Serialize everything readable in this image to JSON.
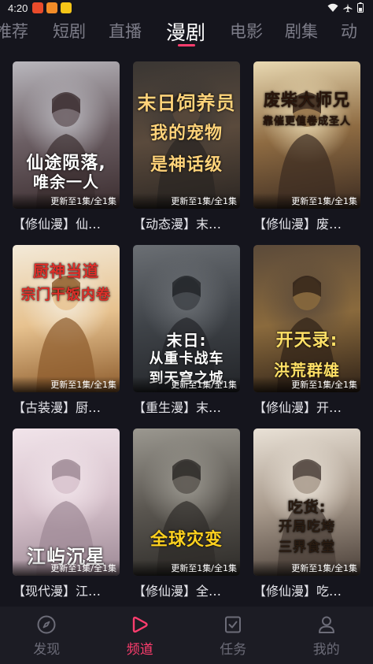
{
  "status_bar": {
    "time": "4:20"
  },
  "tabs": [
    {
      "label": "推荐"
    },
    {
      "label": "短剧"
    },
    {
      "label": "直播"
    },
    {
      "label": "漫剧",
      "active": true
    },
    {
      "label": "电影"
    },
    {
      "label": "剧集"
    },
    {
      "label": "动"
    }
  ],
  "cards": [
    {
      "title": "【修仙漫】仙…",
      "badge": "更新至1集/全1集",
      "cover_text": [
        "仙途陨落,",
        "唯余一人"
      ],
      "palette": [
        "#b9b7bd",
        "#6b5e63",
        "#3b2d2f"
      ],
      "accent": "#ffffff"
    },
    {
      "title": "【动态漫】末…",
      "badge": "更新至1集/全1集",
      "cover_text": [
        "末日饲养员",
        "我的宠物",
        "是神话级"
      ],
      "palette": [
        "#3a3633",
        "#5a4a3c",
        "#2a2522"
      ],
      "accent": "#ffd37a"
    },
    {
      "title": "【修仙漫】废…",
      "badge": "更新至1集/全1集",
      "cover_text": [
        "废柴大师兄",
        "靠催更值卷成圣人"
      ],
      "palette": [
        "#e9d9b2",
        "#8e6b42",
        "#3b2b21"
      ],
      "accent": "#2a160c"
    },
    {
      "title": "【古装漫】厨…",
      "badge": "更新至1集/全1集",
      "cover_text": [
        "厨神当道",
        "宗门干饭内卷"
      ],
      "palette": [
        "#f3ead9",
        "#e7c28f",
        "#8b5a2b"
      ],
      "accent": "#e0302a"
    },
    {
      "title": "【重生漫】末…",
      "badge": "更新至1集/全1集",
      "cover_text": [
        "末日:",
        "从重卡战车",
        "到天穹之城"
      ],
      "palette": [
        "#6b6f74",
        "#3f4348",
        "#222428"
      ],
      "accent": "#ffffff"
    },
    {
      "title": "【修仙漫】开…",
      "badge": "更新至1集/全1集",
      "cover_text": [
        "开天录:",
        "洪荒群雄"
      ],
      "palette": [
        "#5b4a3a",
        "#8a6a3d",
        "#2e2117"
      ],
      "accent": "#ffe066"
    },
    {
      "title": "【现代漫】江…",
      "badge": "更新至1集/全1集",
      "cover_text": [
        "江屿沉星"
      ],
      "palette": [
        "#f1e4ea",
        "#d7c2cc",
        "#9c8894"
      ],
      "accent": "#ffffff"
    },
    {
      "title": "【修仙漫】全…",
      "badge": "更新至1集/全1集",
      "cover_text": [
        "全球灾变"
      ],
      "palette": [
        "#9b9890",
        "#5a5650",
        "#2d2b28"
      ],
      "accent": "#ffd21f"
    },
    {
      "title": "【修仙漫】吃…",
      "badge": "更新至1集/全1集",
      "cover_text": [
        "吃货:",
        "开局吃垮",
        "三界食堂"
      ],
      "palette": [
        "#e9e1d6",
        "#a89a8c",
        "#4a3f38"
      ],
      "accent": "#2a1c12"
    }
  ],
  "bottom_nav": [
    {
      "label": "发现",
      "icon": "compass-icon"
    },
    {
      "label": "频道",
      "icon": "play-icon",
      "active": true
    },
    {
      "label": "任务",
      "icon": "task-check-icon"
    },
    {
      "label": "我的",
      "icon": "person-icon"
    }
  ],
  "colors": {
    "accent": "#ff3d6e",
    "background": "#15151d",
    "nav_background": "#1c1c24"
  }
}
